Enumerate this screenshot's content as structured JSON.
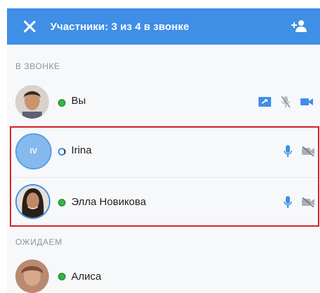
{
  "header": {
    "title": "Участники: 3 из 4 в звонке",
    "close_icon": "close-icon",
    "add_icon": "add-user-icon",
    "background": "#3f8fe6"
  },
  "sections": {
    "in_call": "В ЗВОНКЕ",
    "waiting": "ОЖИДАЕМ"
  },
  "participants": [
    {
      "name": "Вы",
      "status": "online",
      "icons": [
        "screen-share-icon",
        "mic-muted-icon",
        "camera-icon"
      ]
    },
    {
      "name": "Irina",
      "initials": "IV",
      "status": "connecting",
      "icons": [
        "mic-icon",
        "camera-off-icon"
      ]
    },
    {
      "name": "Элла Новикова",
      "status": "online",
      "icons": [
        "mic-icon",
        "camera-off-icon"
      ]
    },
    {
      "name": "Алиса",
      "status": "online",
      "icons": []
    }
  ],
  "colors": {
    "accent": "#3f8fe6",
    "online": "#3cb34a",
    "highlight": "#d8232a"
  }
}
